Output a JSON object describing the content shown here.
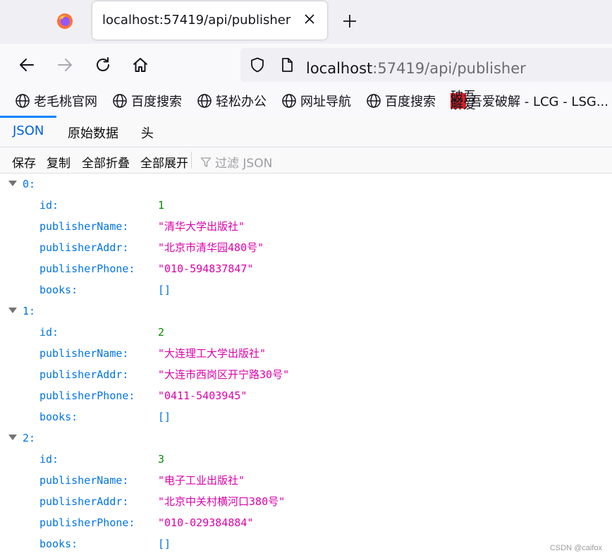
{
  "browser": {
    "tab_title": "localhost:57419/api/publisher",
    "url_host": "localhost",
    "url_rest": ":57419/api/publisher"
  },
  "bookmarks": [
    {
      "label": "老毛桃官网",
      "icon": "globe-icon"
    },
    {
      "label": "百度搜索",
      "icon": "globe-icon"
    },
    {
      "label": "轻松办公",
      "icon": "globe-icon"
    },
    {
      "label": "网址导航",
      "icon": "globe-icon"
    },
    {
      "label": "百度搜索",
      "icon": "globe-icon"
    },
    {
      "label": "吾爱破解 - LCG - LSG...",
      "icon": "52pojie-icon",
      "badge_chars": [
        "破",
        "吾",
        "解",
        "爱"
      ]
    }
  ],
  "viewer": {
    "tabs": [
      "JSON",
      "原始数据",
      "头"
    ],
    "active_tab": "JSON",
    "toolbar": {
      "save": "保存",
      "copy": "复制",
      "collapse_all": "全部折叠",
      "expand_all": "全部展开",
      "filter_placeholder": "过滤 JSON"
    }
  },
  "json_rows": [
    {
      "type": "index",
      "label": "0:"
    },
    {
      "type": "field",
      "key": "id:",
      "value": "1",
      "kind": "num"
    },
    {
      "type": "field",
      "key": "publisherName:",
      "value": "\"清华大学出版社\"",
      "kind": "str"
    },
    {
      "type": "field",
      "key": "publisherAddr:",
      "value": "\"北京市清华园480号\"",
      "kind": "str"
    },
    {
      "type": "field",
      "key": "publisherPhone:",
      "value": "\"010-594837847\"",
      "kind": "str"
    },
    {
      "type": "field",
      "key": "books:",
      "value": "[]",
      "kind": "arr"
    },
    {
      "type": "index",
      "label": "1:"
    },
    {
      "type": "field",
      "key": "id:",
      "value": "2",
      "kind": "num"
    },
    {
      "type": "field",
      "key": "publisherName:",
      "value": "\"大连理工大学出版社\"",
      "kind": "str"
    },
    {
      "type": "field",
      "key": "publisherAddr:",
      "value": "\"大连市西岗区开宁路30号\"",
      "kind": "str"
    },
    {
      "type": "field",
      "key": "publisherPhone:",
      "value": "\"0411-5403945\"",
      "kind": "str"
    },
    {
      "type": "field",
      "key": "books:",
      "value": "[]",
      "kind": "arr"
    },
    {
      "type": "index",
      "label": "2:"
    },
    {
      "type": "field",
      "key": "id:",
      "value": "3",
      "kind": "num"
    },
    {
      "type": "field",
      "key": "publisherName:",
      "value": "\"电子工业出版社\"",
      "kind": "str"
    },
    {
      "type": "field",
      "key": "publisherAddr:",
      "value": "\"北京中关村横河口380号\"",
      "kind": "str"
    },
    {
      "type": "field",
      "key": "publisherPhone:",
      "value": "\"010-029384884\"",
      "kind": "str"
    },
    {
      "type": "field",
      "key": "books:",
      "value": "[]",
      "kind": "arr"
    }
  ],
  "watermark": "CSDN @caifox",
  "colors": {
    "json_key": "#0074e8",
    "json_number": "#058b00",
    "json_string": "#dd00a9",
    "active_tab": "#0060df"
  }
}
